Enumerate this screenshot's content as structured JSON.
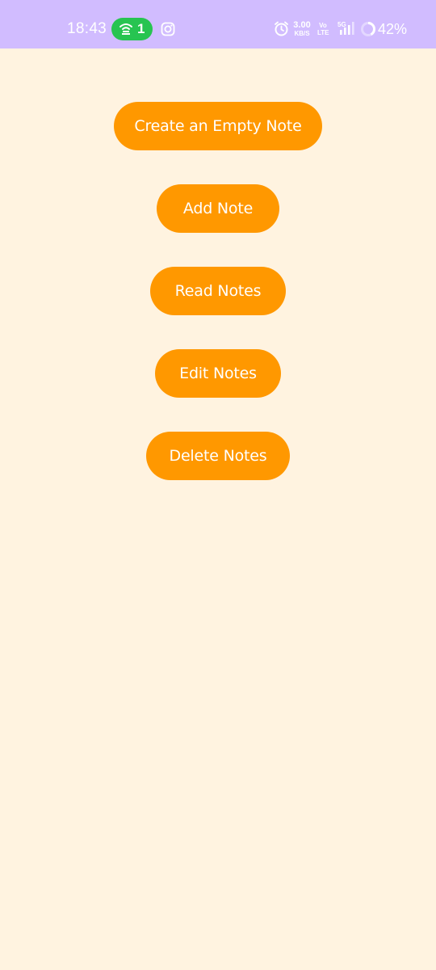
{
  "status_bar": {
    "time": "18:43",
    "hotspot_count": "1",
    "net_speed_value": "3.00",
    "net_speed_unit": "KB/S",
    "volte_top": "Vo",
    "volte_bottom": "LTE",
    "network_type": "5G",
    "battery_percent": "42%",
    "background_color": "#D1BCFF",
    "hotspot_color": "#27C451",
    "icons": [
      "hotspot-icon",
      "instagram-icon",
      "alarm-icon",
      "signal-icon",
      "battery-icon"
    ]
  },
  "main": {
    "background_color": "#FFF3E0",
    "button_color": "#FF9800",
    "buttons": [
      {
        "label": "Create an Empty Note"
      },
      {
        "label": "Add Note"
      },
      {
        "label": "Read Notes"
      },
      {
        "label": "Edit Notes"
      },
      {
        "label": "Delete Notes"
      }
    ]
  }
}
